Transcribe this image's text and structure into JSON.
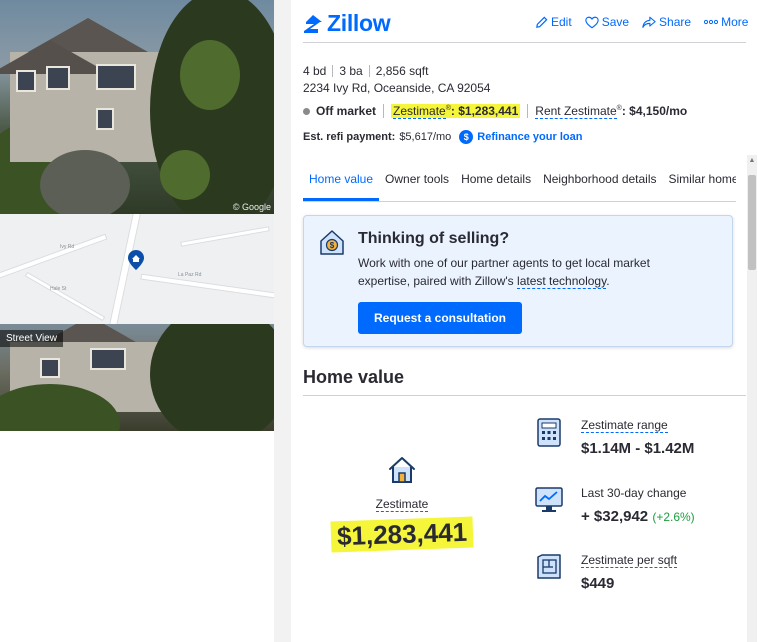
{
  "brand": {
    "name": "Zillow"
  },
  "actions": [
    {
      "label": "Edit",
      "icon": "pencil-icon"
    },
    {
      "label": "Save",
      "icon": "heart-icon"
    },
    {
      "label": "Share",
      "icon": "share-icon"
    },
    {
      "label": "More",
      "icon": "dots-icon"
    }
  ],
  "property": {
    "beds": "4 bd",
    "baths": "3 ba",
    "sqft": "2,856 sqft",
    "address": "2234 Ivy Rd, Oceanside, CA 92054",
    "status": "Off market",
    "zestimate_label": "Zestimate",
    "zestimate_value": ": $1,283,441",
    "rent_label": "Rent Zestimate",
    "rent_value": ": $4,150/mo",
    "refi_label": "Est. refi payment:",
    "refi_value": "$5,617/mo",
    "refi_link": "Refinance your loan",
    "registered_mark": "®"
  },
  "media": {
    "street_view_label": "Street View",
    "google_mark": "© Google",
    "map_labels": [
      "Ivy Rd",
      "La Paz Rd",
      "Hale St"
    ]
  },
  "tabs": [
    {
      "label": "Home value",
      "active": true
    },
    {
      "label": "Owner tools",
      "active": false
    },
    {
      "label": "Home details",
      "active": false
    },
    {
      "label": "Neighborhood details",
      "active": false
    },
    {
      "label": "Similar home",
      "active": false
    }
  ],
  "selling_card": {
    "title": "Thinking of selling?",
    "body_prefix": "Work with one of our partner agents to get local market expertise, paired with Zillow's ",
    "body_link": "latest technology",
    "body_suffix": ".",
    "button": "Request a consultation"
  },
  "home_value": {
    "title": "Home value",
    "zestimate_label": "Zestimate",
    "zestimate_value": "$1,283,441",
    "metrics": [
      {
        "label": "Zestimate range",
        "value": "$1.14M - $1.42M",
        "icon": "calculator-icon"
      },
      {
        "label": "Last 30-day change",
        "value": "+ $32,942",
        "change": "(+2.6%)",
        "icon": "monitor-chart-icon"
      },
      {
        "label": "Zestimate per sqft",
        "value": "$449",
        "icon": "blueprint-icon"
      }
    ]
  },
  "colors": {
    "accent": "#006aff",
    "highlight": "#f5f53a",
    "positive": "#1b9e3e"
  }
}
